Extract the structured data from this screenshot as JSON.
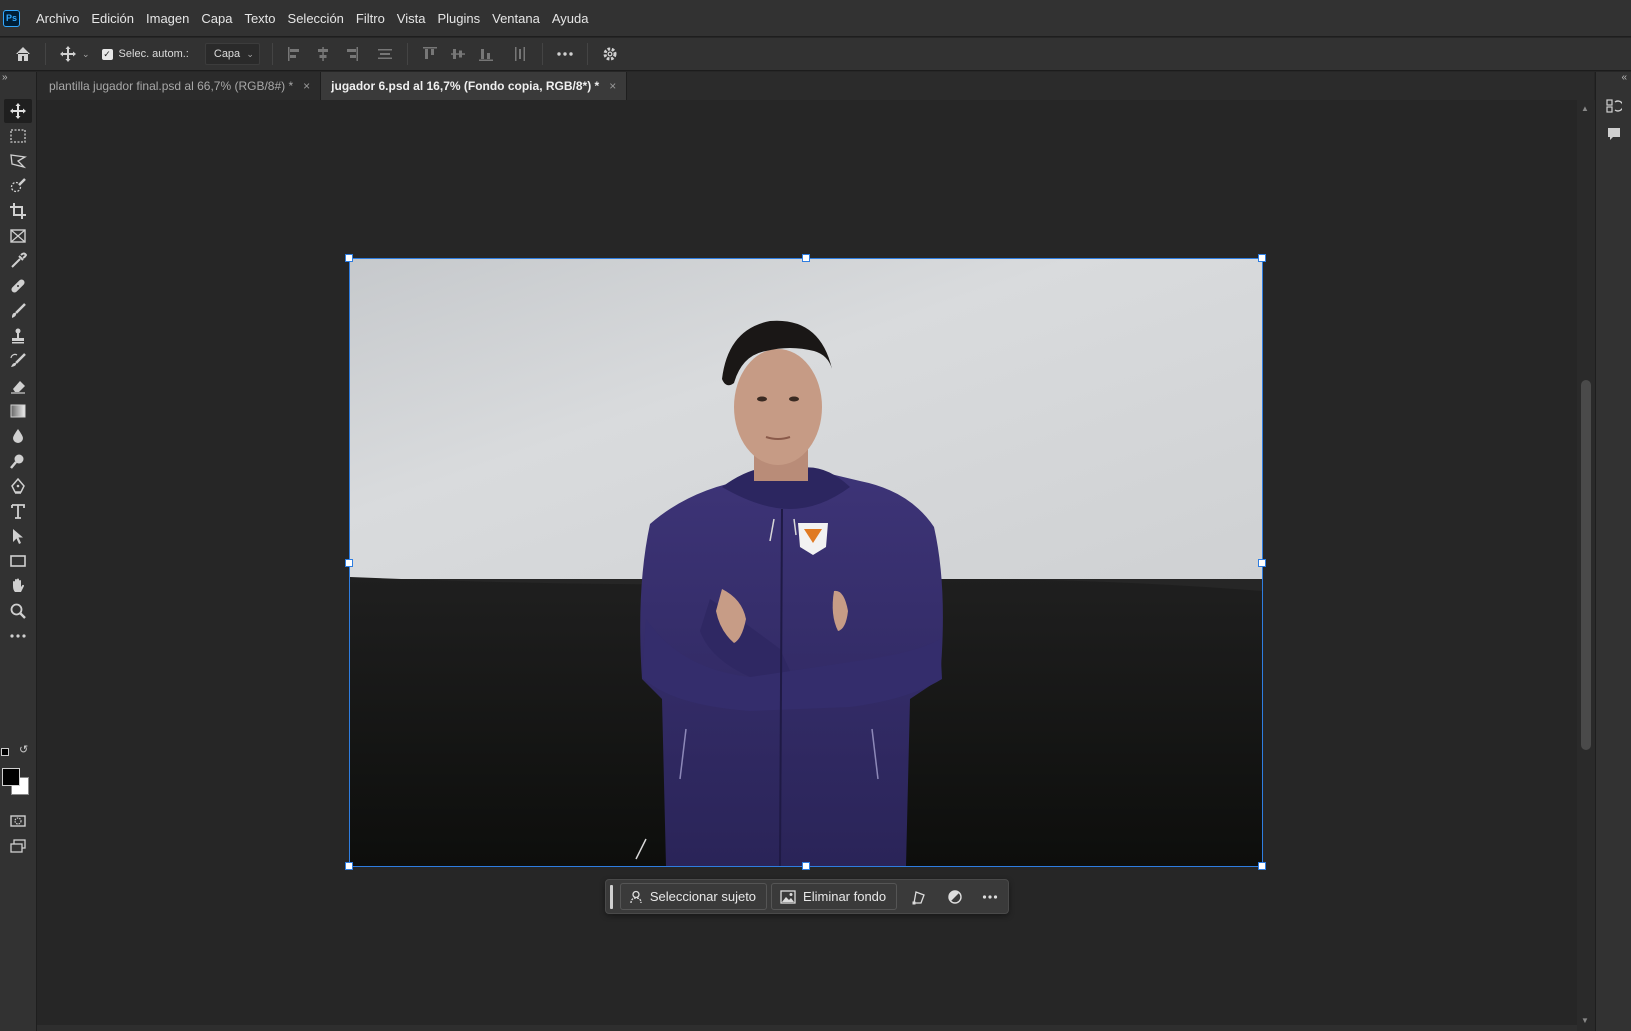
{
  "menu": {
    "logo": "Ps",
    "items": [
      "Archivo",
      "Edición",
      "Imagen",
      "Capa",
      "Texto",
      "Selección",
      "Filtro",
      "Vista",
      "Plugins",
      "Ventana",
      "Ayuda"
    ]
  },
  "options": {
    "auto_select_label": "Selec. autom.:",
    "auto_select_checked": true,
    "target_value": "Capa"
  },
  "tabs": [
    {
      "label": "plantilla jugador final.psd al 66,7% (RGB/8#) *",
      "active": false
    },
    {
      "label": "jugador 6.psd al 16,7% (Fondo copia, RGB/8*) *",
      "active": true
    }
  ],
  "taskbar": {
    "select_subject": "Seleccionar sujeto",
    "remove_background": "Eliminar fondo"
  },
  "colors": {
    "accent": "#2e7de0",
    "foreground_swatch": "#000000",
    "background_swatch": "#ffffff"
  }
}
